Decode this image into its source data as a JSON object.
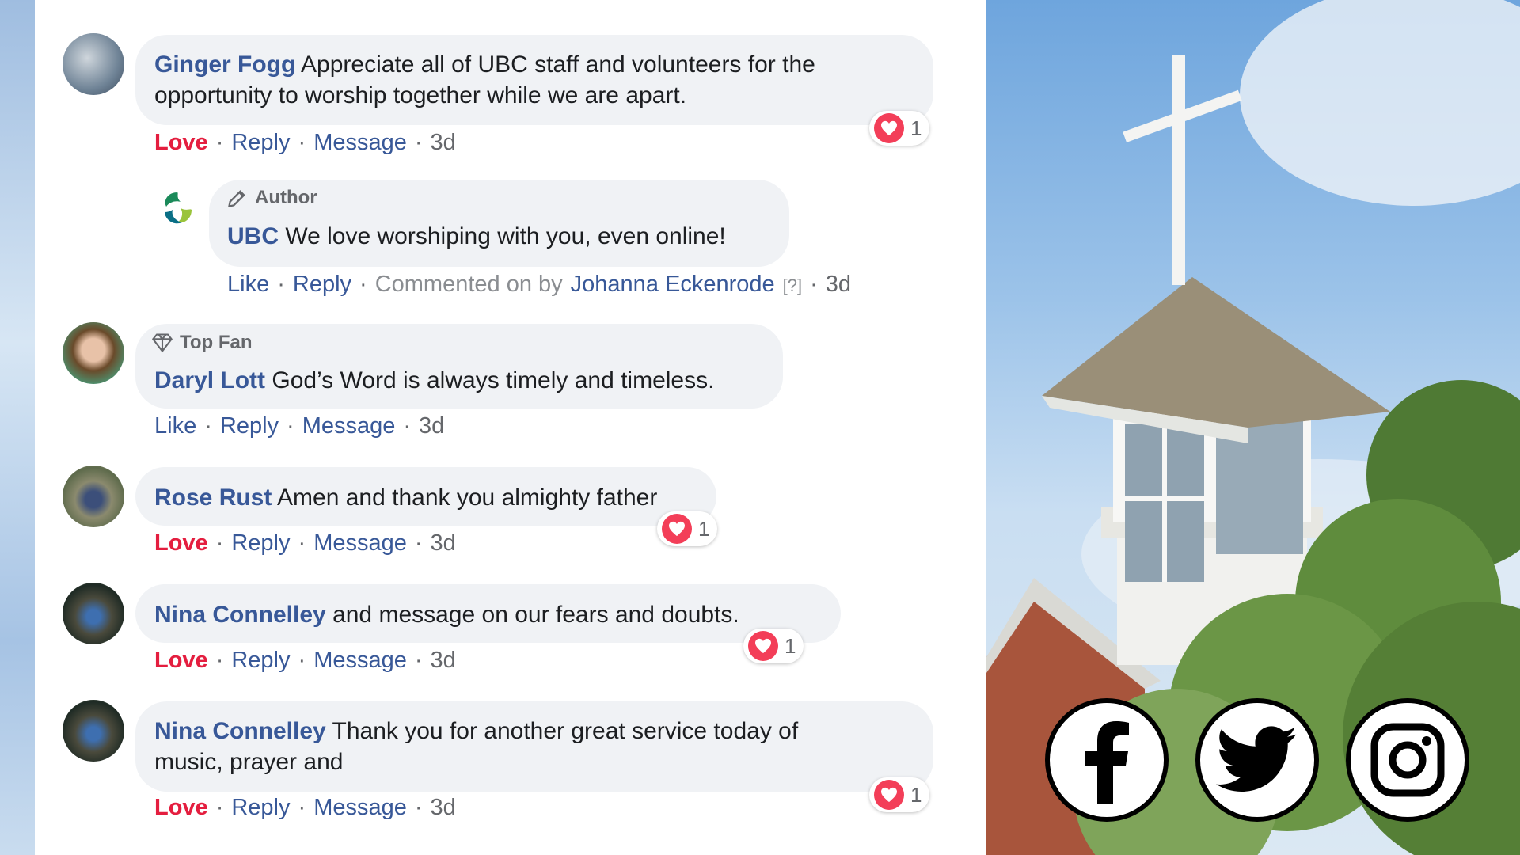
{
  "comments": [
    {
      "author": "Ginger Fogg",
      "text_line1": "Appreciate all of UBC staff and volunteers for the",
      "text_line2": "opportunity to worship together while we are apart.",
      "action_primary": "Love",
      "reply": "Reply",
      "message": "Message",
      "time": "3d",
      "reaction_count": "1"
    },
    {
      "badge": "Author",
      "author": "UBC",
      "text": "We love worshiping with you, even online!",
      "action_primary": "Like",
      "reply": "Reply",
      "commented_on_by": "Commented on by",
      "commenter": "Johanna Eckenrode",
      "help": "[?]",
      "time": "3d"
    },
    {
      "badge": "Top Fan",
      "author": "Daryl Lott",
      "text": "God’s Word is always timely and timeless.",
      "action_primary": "Like",
      "reply": "Reply",
      "message": "Message",
      "time": "3d"
    },
    {
      "author": "Rose Rust",
      "text": "Amen and thank you almighty father",
      "action_primary": "Love",
      "reply": "Reply",
      "message": "Message",
      "time": "3d",
      "reaction_count": "1"
    },
    {
      "author": "Nina Connelley",
      "text": "and message on our fears and doubts.",
      "action_primary": "Love",
      "reply": "Reply",
      "message": "Message",
      "time": "3d",
      "reaction_count": "1"
    },
    {
      "author": "Nina Connelley",
      "text_line1": "Thank you for another great service today of",
      "text_line2": "music, prayer and",
      "action_primary": "Love",
      "reply": "Reply",
      "message": "Message",
      "time": "3d",
      "reaction_count": "1"
    }
  ],
  "separator": "·",
  "icons": {
    "badge_author": "pencil-icon",
    "badge_topfan": "diamond-icon",
    "reaction": "heart-icon",
    "social": [
      "facebook-icon",
      "twitter-icon",
      "instagram-icon"
    ]
  },
  "colors": {
    "name": "#385898",
    "love": "#e41e3f",
    "bubble": "#f0f2f5",
    "heart": "#f33e58"
  }
}
